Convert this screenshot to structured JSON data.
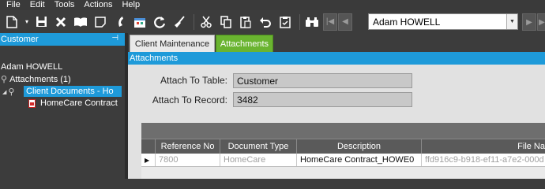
{
  "menu": {
    "items": [
      "File",
      "Edit",
      "Tools",
      "Actions",
      "Help"
    ]
  },
  "toolbar": {
    "icons": [
      "new-document-icon",
      "dropdown-arrow-icon",
      "save-icon",
      "delete-icon",
      "book-icon",
      "note-icon",
      "phone-icon",
      "calendar-icon",
      "refresh-icon",
      "broom-icon",
      "cut-icon",
      "copy-icon",
      "paste-icon",
      "undo-icon",
      "clipboard-icon",
      "binoculars-icon",
      "first-record-icon",
      "previous-record-icon",
      "next-record-icon",
      "last-record-icon"
    ],
    "record_selector": {
      "value": "Adam HOWELL"
    }
  },
  "left_panel": {
    "header": "Customer",
    "tree": {
      "root": "Adam HOWELL",
      "attachments": "Attachments (1)",
      "folder": "Client Documents - Ho",
      "file": "HomeCare Contract"
    }
  },
  "tabs": {
    "client_maintenance": "Client Maintenance",
    "attachments": "Attachments"
  },
  "section": {
    "title": "Attachments"
  },
  "form": {
    "attach_to_table_label": "Attach To Table:",
    "attach_to_table_value": "Customer",
    "attach_to_record_label": "Attach To Record:",
    "attach_to_record_value": "3482"
  },
  "grid": {
    "columns": [
      "Reference No",
      "Document Type",
      "Description",
      "File Na"
    ],
    "rows": [
      {
        "reference_no": "7800",
        "document_type": "HomeCare",
        "description": "HomeCare Contract_HOWE0",
        "file_name": "ffd916c9-b918-ef11-a7e2-000d"
      }
    ]
  },
  "colors": {
    "accent_blue": "#1e9ad9",
    "active_tab_green": "#6ab430",
    "dark_bg": "#3c3c3c"
  }
}
